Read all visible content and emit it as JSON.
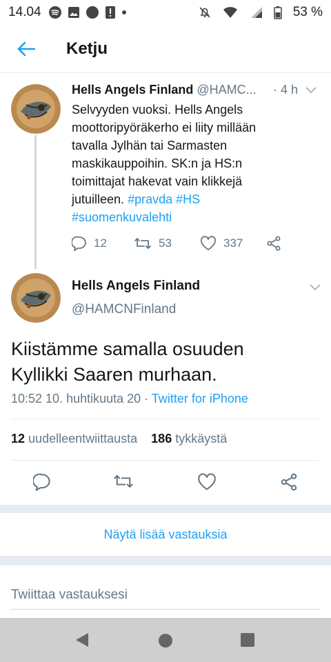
{
  "status_bar": {
    "time": "14.04",
    "battery": "53 %"
  },
  "header": {
    "title": "Ketju"
  },
  "reply_tweet": {
    "name": "Hells Angels Finland",
    "handle": "@HAMC...",
    "time": "· 4 h",
    "text_lines": [
      "Selvyyden vuoksi. Hells Angels",
      "moottoripyöräkerho ei liity millään",
      "tavalla Jylhän tai Sarmasten",
      "maskikauppoihin. SK:n ja HS:n",
      "toimittajat hakevat vain klikkejä"
    ],
    "text_last_line": "jutuilleen.",
    "hashtags": [
      "#pravda",
      "#HS",
      "#suomenkuvalehti"
    ],
    "replies": "12",
    "retweets": "53",
    "likes": "337"
  },
  "main_tweet": {
    "name": "Hells Angels Finland",
    "handle": "@HAMCNFinland",
    "text_line1": "Kiistämme samalla osuuden",
    "text_line2": "Kyllikki Saaren murhaan.",
    "timestamp": "10:52 10. huhtikuuta 20",
    "separator": " · ",
    "client": "Twitter for iPhone",
    "retweet_count": "12",
    "retweet_label": "uudelleentwiittausta",
    "like_count": "186",
    "like_label": "tykkäystä"
  },
  "more_replies": "Näytä lisää vastauksia",
  "reply_placeholder": "Twiittaa vastauksesi",
  "colors": {
    "accent": "#1da1f2",
    "secondary_text": "#657786",
    "divider": "#e6ecf0"
  }
}
